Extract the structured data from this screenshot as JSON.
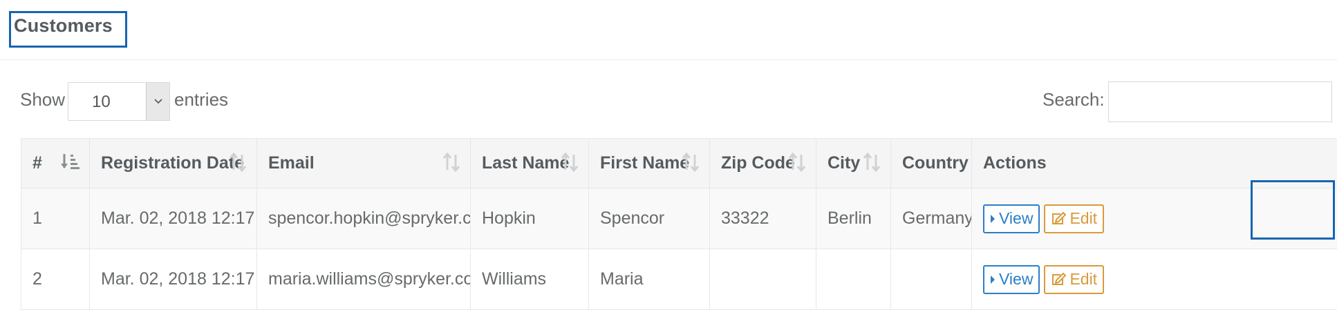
{
  "page": {
    "title": "Customers"
  },
  "controls": {
    "show_label": "Show",
    "page_size": "10",
    "entries_label": "entries",
    "search_label": "Search:",
    "search_value": ""
  },
  "table": {
    "columns": [
      "#",
      "Registration Date",
      "Email",
      "Last Name",
      "First Name",
      "Zip Code",
      "City",
      "Country",
      "Actions"
    ],
    "rows": [
      {
        "id": "1",
        "registration_date": "Mar. 02, 2018 12:17",
        "email": "spencor.hopkin@spryker.com",
        "last_name": "Hopkin",
        "first_name": "Spencor",
        "zip_code": "33322",
        "city": "Berlin",
        "country": "Germany",
        "view_label": "View",
        "edit_label": "Edit"
      },
      {
        "id": "2",
        "registration_date": "Mar. 02, 2018 12:17",
        "email": "maria.williams@spryker.com",
        "last_name": "Williams",
        "first_name": "Maria",
        "zip_code": "",
        "city": "",
        "country": "",
        "view_label": "View",
        "edit_label": "Edit"
      }
    ]
  },
  "colors": {
    "highlight": "#1565b0",
    "view_button": "#2a7ec8",
    "edit_button": "#d99a3a"
  },
  "icons": {
    "sort_active": "sort-amount-asc-icon",
    "sort": "sort-both-icon",
    "view": "caret-right-icon",
    "edit": "edit-icon",
    "select": "chevron-down-icon"
  }
}
